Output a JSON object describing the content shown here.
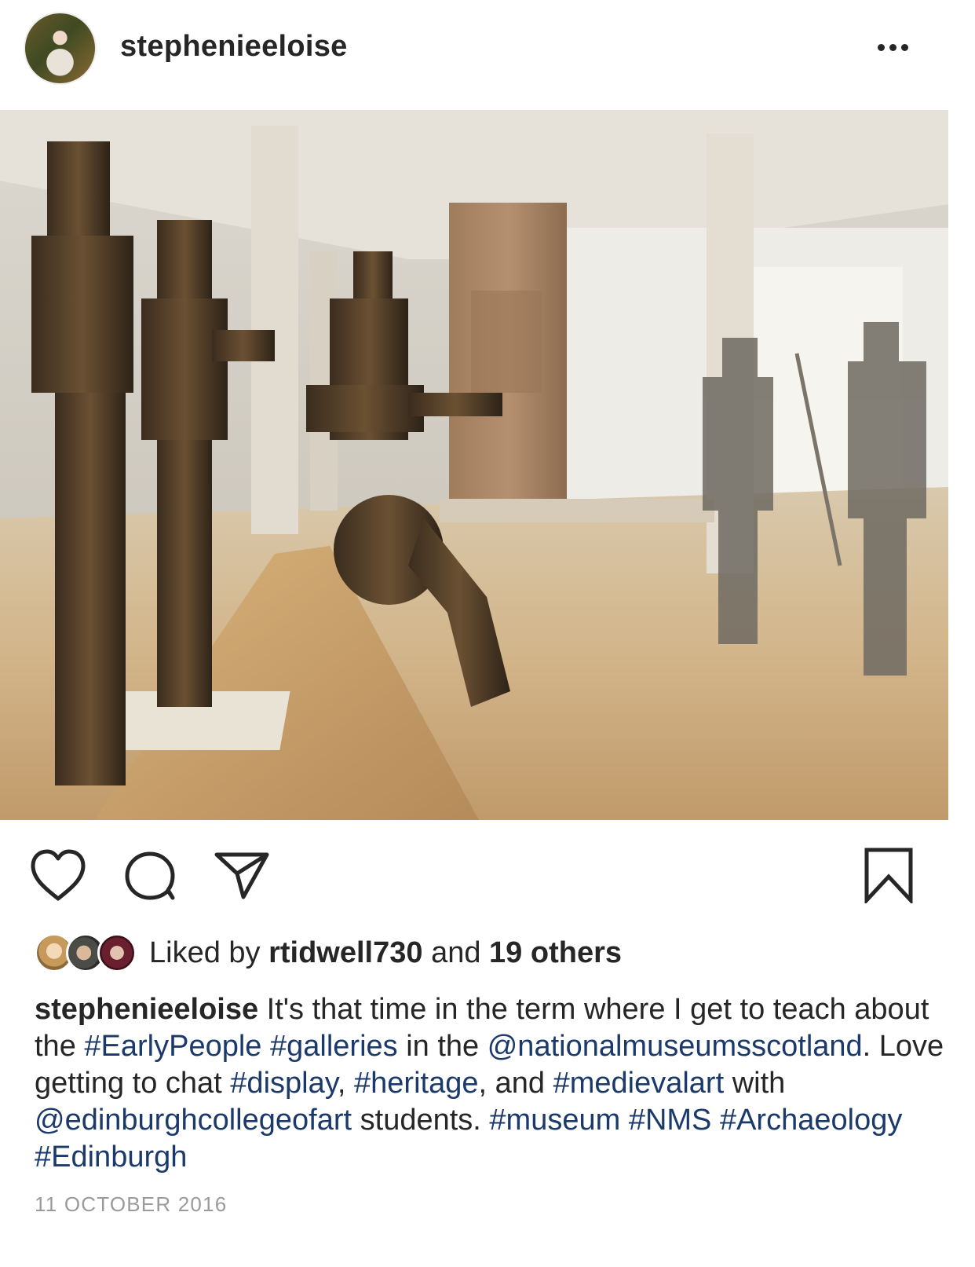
{
  "header": {
    "username": "stephenieeloise"
  },
  "actions": {
    "like_icon": "heart-icon",
    "comment_icon": "comment-icon",
    "share_icon": "paper-plane-icon",
    "save_icon": "bookmark-icon"
  },
  "likes": {
    "prefix": "Liked by ",
    "user": "rtidwell730",
    "middle": " and ",
    "others": "19 others"
  },
  "caption": {
    "username": "stephenieeloise",
    "segments": [
      {
        "t": " It's that time in the term where I get to teach about the ",
        "tag": false
      },
      {
        "t": "#EarlyPeople",
        "tag": true
      },
      {
        "t": " ",
        "tag": false
      },
      {
        "t": "#galleries",
        "tag": true
      },
      {
        "t": " in the ",
        "tag": false
      },
      {
        "t": "@nationalmuseumsscotland",
        "tag": true
      },
      {
        "t": ". Love getting to chat ",
        "tag": false
      },
      {
        "t": "#display",
        "tag": true
      },
      {
        "t": ", ",
        "tag": false
      },
      {
        "t": "#heritage",
        "tag": true
      },
      {
        "t": ", and ",
        "tag": false
      },
      {
        "t": "#medievalart",
        "tag": true
      },
      {
        "t": " with ",
        "tag": false
      },
      {
        "t": "@edinburghcollegeofart",
        "tag": true
      },
      {
        "t": " students. ",
        "tag": false
      },
      {
        "t": "#museum",
        "tag": true
      },
      {
        "t": " ",
        "tag": false
      },
      {
        "t": "#NMS",
        "tag": true
      },
      {
        "t": " ",
        "tag": false
      },
      {
        "t": "#Archaeology",
        "tag": true
      },
      {
        "t": " ",
        "tag": false
      },
      {
        "t": "#Edinburgh",
        "tag": true
      }
    ]
  },
  "timestamp": "11 OCTOBER 2016",
  "colors": {
    "text": "#262626",
    "link": "#1b3a6b",
    "muted": "#9a9a9a"
  }
}
